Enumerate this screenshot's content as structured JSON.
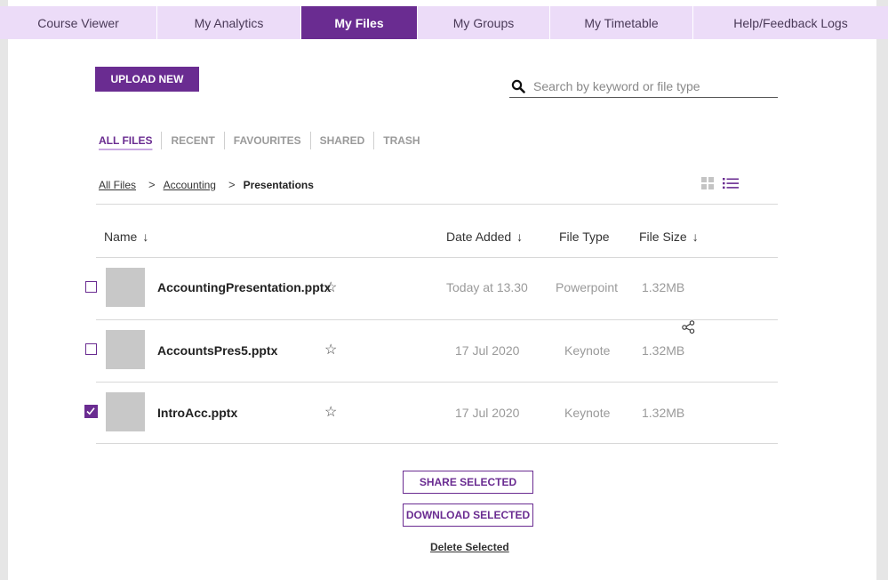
{
  "nav": {
    "tabs": [
      {
        "label": "Course Viewer"
      },
      {
        "label": "My Analytics"
      },
      {
        "label": "My Files"
      },
      {
        "label": "My Groups"
      },
      {
        "label": "My Timetable"
      },
      {
        "label": "Help/Feedback Logs"
      }
    ],
    "active_tab": "My Files"
  },
  "toolbar": {
    "upload_label": "UPLOAD NEW"
  },
  "search": {
    "placeholder": "Search by keyword or file type",
    "value": "",
    "icon": "search-icon"
  },
  "file_tabs": [
    {
      "label": "ALL FILES"
    },
    {
      "label": "RECENT"
    },
    {
      "label": "FAVOURITES"
    },
    {
      "label": "SHARED"
    },
    {
      "label": "TRASH"
    }
  ],
  "breadcrumb": {
    "items": [
      "All Files",
      "Accounting"
    ],
    "separator": ">",
    "current": "Presentations"
  },
  "table": {
    "headers": {
      "name": "Name",
      "date_added": "Date Added",
      "file_type": "File Type",
      "file_size": "File Size"
    },
    "sort_icon": "↓",
    "rows": [
      {
        "name": "AccountingPresentation.pptx",
        "date_added": "Today at 13.30",
        "file_type": "Powerpoint",
        "file_size": "1.32MB",
        "checked": false
      },
      {
        "name": "AccountsPres5.pptx",
        "date_added": "17 Jul 2020",
        "file_type": "Keynote",
        "file_size": "1.32MB",
        "checked": false
      },
      {
        "name": "IntroAcc.pptx",
        "date_added": "17 Jul 2020",
        "file_type": "Keynote",
        "file_size": "1.32MB",
        "checked": true
      }
    ]
  },
  "actions": {
    "share_label": "SHARE SELECTED",
    "download_label": "DOWNLOAD SELECTED",
    "delete_label": "Delete Selected"
  },
  "colors": {
    "accent": "#6a2c91",
    "nav_bg": "#ecdcf8",
    "thumb": "#c8c8c8"
  }
}
